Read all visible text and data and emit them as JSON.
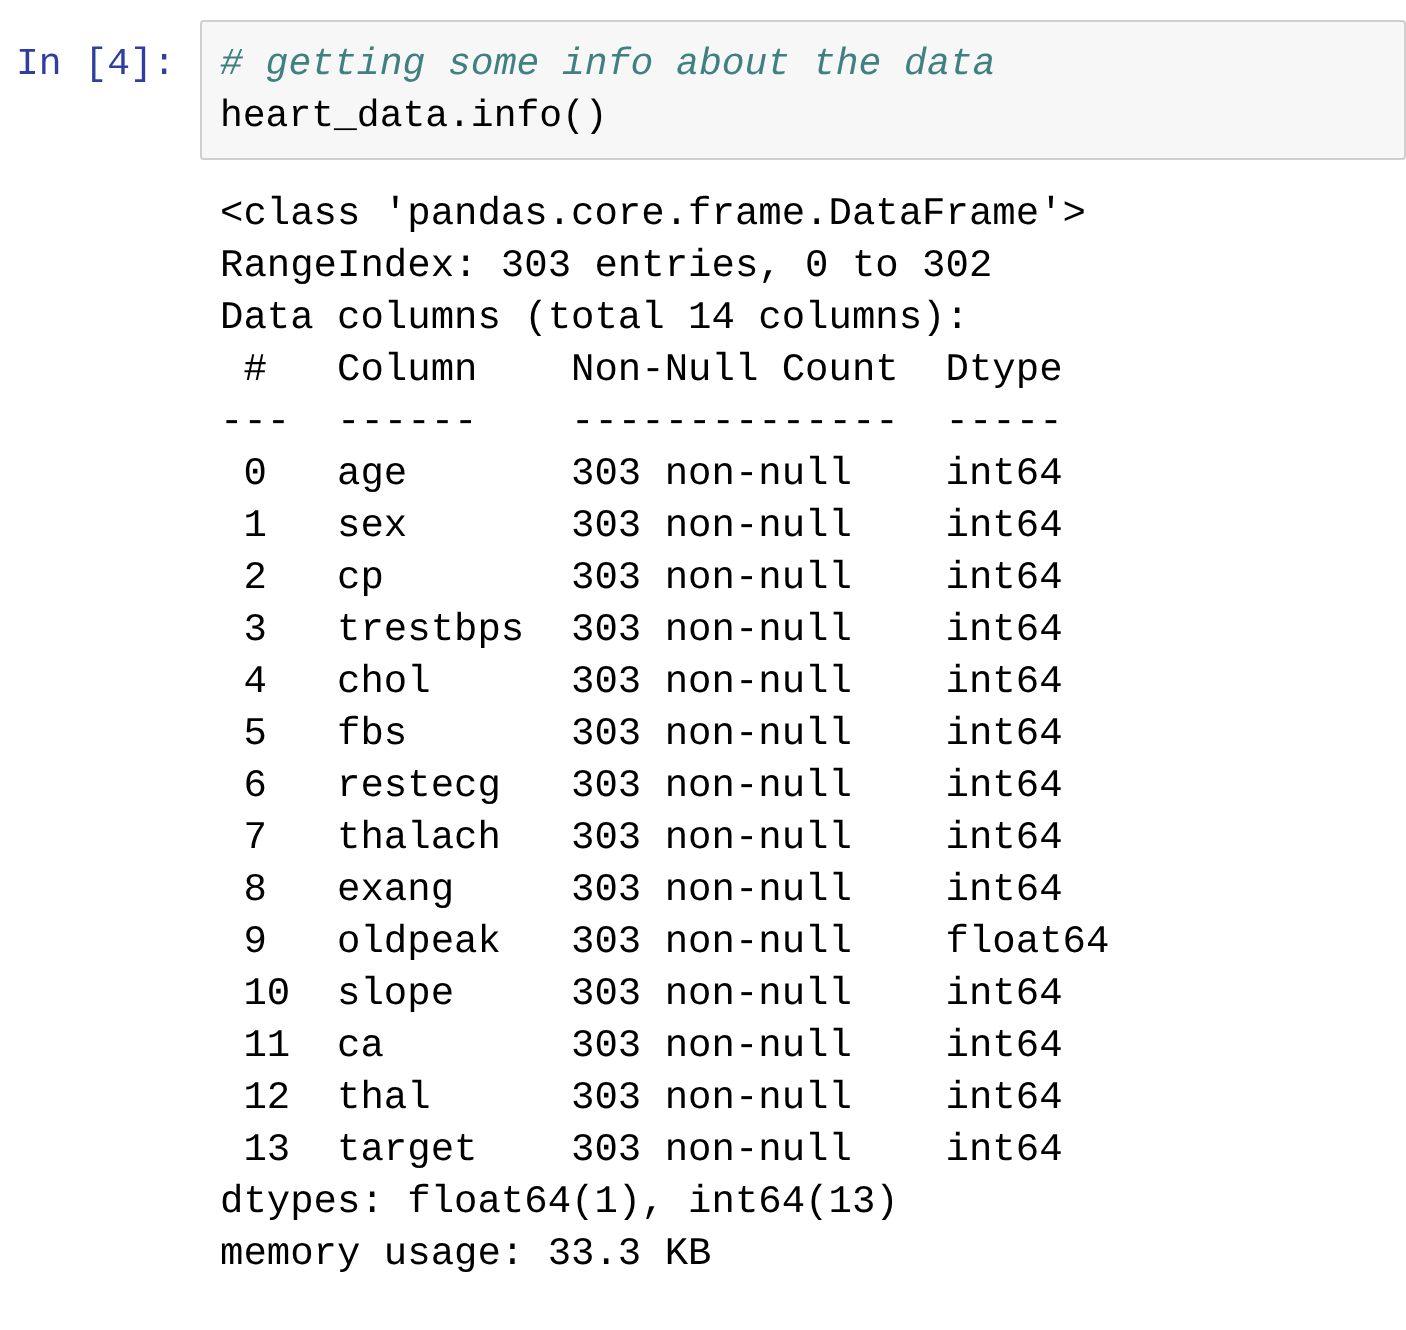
{
  "cell": {
    "prompt": "In [4]:",
    "input": [
      {
        "kind": "comment",
        "text": "# getting some info about the data"
      },
      {
        "kind": "code",
        "text": "heart_data.info()"
      }
    ],
    "output": [
      "<class 'pandas.core.frame.DataFrame'>",
      "RangeIndex: 303 entries, 0 to 302",
      "Data columns (total 14 columns):",
      " #   Column    Non-Null Count  Dtype  ",
      "---  ------    --------------  -----  ",
      " 0   age       303 non-null    int64  ",
      " 1   sex       303 non-null    int64  ",
      " 2   cp        303 non-null    int64  ",
      " 3   trestbps  303 non-null    int64  ",
      " 4   chol      303 non-null    int64  ",
      " 5   fbs       303 non-null    int64  ",
      " 6   restecg   303 non-null    int64  ",
      " 7   thalach   303 non-null    int64  ",
      " 8   exang     303 non-null    int64  ",
      " 9   oldpeak   303 non-null    float64",
      " 10  slope     303 non-null    int64  ",
      " 11  ca        303 non-null    int64  ",
      " 12  thal      303 non-null    int64  ",
      " 13  target    303 non-null    int64  ",
      "dtypes: float64(1), int64(13)",
      "memory usage: 33.3 KB"
    ]
  }
}
